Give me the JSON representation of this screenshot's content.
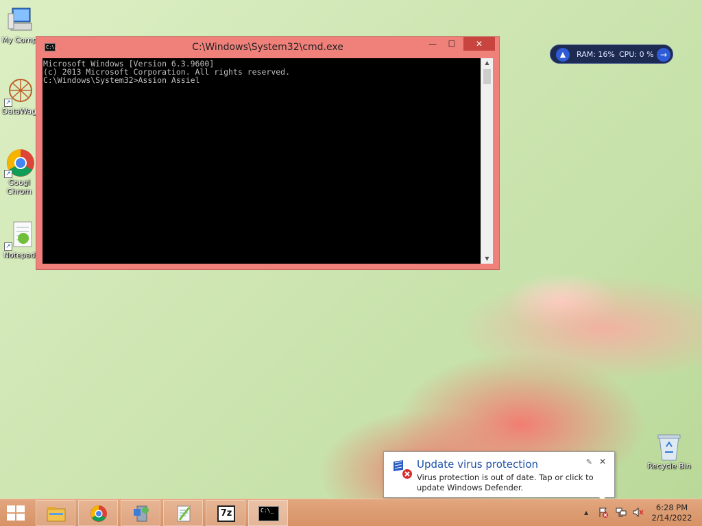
{
  "desktop": {
    "icons": [
      {
        "label": "My Comp",
        "icon": "computer-icon"
      },
      {
        "label": "DataWag",
        "icon": "datawagon-icon"
      },
      {
        "label": "Googl",
        "label2": "Chrom",
        "icon": "chrome-icon"
      },
      {
        "label": "Notepad",
        "icon": "notepad-icon"
      }
    ],
    "recycle_bin": {
      "label": "Recycle Bin",
      "icon": "recycle-bin-icon"
    }
  },
  "cmd": {
    "title": "C:\\Windows\\System32\\cmd.exe",
    "icon_text": "C:\\.",
    "lines": [
      "Microsoft Windows [Version 6.3.9600]",
      "(c) 2013 Microsoft Corporation. All rights reserved.",
      "",
      "C:\\Windows\\System32>Assion Assiel"
    ],
    "min_glyph": "—",
    "max_glyph": "☐",
    "close_glyph": "✕"
  },
  "gadget": {
    "ram": "RAM: 16%",
    "cpu": "CPU: 0 %",
    "rocket_glyph": "▲",
    "arrow_glyph": "→"
  },
  "notification": {
    "title": "Update virus protection",
    "message": "Virus protection is out of date. Tap or click to update Windows Defender.",
    "pin_glyph": "✎",
    "close_glyph": "✕"
  },
  "taskbar": {
    "apps": [
      {
        "name": "file-explorer-icon"
      },
      {
        "name": "chrome-icon"
      },
      {
        "name": "installer-icon"
      },
      {
        "name": "notepad-plus-icon"
      },
      {
        "name": "7zip-icon",
        "text": "7z"
      },
      {
        "name": "cmd-icon",
        "text": "C:\\_"
      }
    ],
    "tray": {
      "show_hidden_glyph": "▲",
      "time": "6:28 PM",
      "date": "2/14/2022"
    }
  },
  "colors": {
    "cmd_frame": "#f0807a",
    "close_button": "#c7453e",
    "taskbar": "#d79266",
    "notification_title": "#1c4fa8"
  }
}
